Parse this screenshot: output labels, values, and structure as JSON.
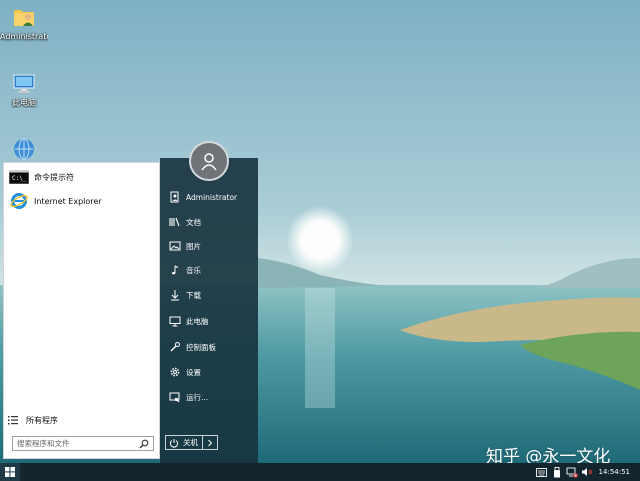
{
  "desktop": {
    "icons": [
      {
        "label": "Administrator",
        "icon": "user-folder-icon"
      },
      {
        "label": "此电脑",
        "icon": "computer-icon"
      },
      {
        "label": "",
        "icon": "network-icon"
      }
    ]
  },
  "start_menu": {
    "apps": [
      {
        "label": "命令提示符",
        "icon": "cmd-icon"
      },
      {
        "label": "Internet Explorer",
        "icon": "ie-icon"
      }
    ],
    "all_programs_label": "所有程序",
    "search": {
      "placeholder": "搜索程序和文件",
      "value": ""
    },
    "user_name": "Administrator",
    "right_items": [
      {
        "label": "文档",
        "icon": "documents-icon"
      },
      {
        "label": "图片",
        "icon": "pictures-icon"
      },
      {
        "label": "音乐",
        "icon": "music-icon"
      },
      {
        "label": "下载",
        "icon": "download-icon"
      },
      {
        "label": "此电脑",
        "icon": "computer-icon"
      },
      {
        "label": "控制面板",
        "icon": "control-panel-icon"
      },
      {
        "label": "设置",
        "icon": "settings-gear-icon"
      },
      {
        "label": "运行...",
        "icon": "run-icon"
      }
    ],
    "power_label": "关机",
    "accent_color": "#18343f"
  },
  "taskbar": {
    "clock": "14:54:51",
    "tray_icons": [
      "keyboard-icon",
      "usb-icon",
      "network-error-icon",
      "volume-muted-icon"
    ]
  },
  "watermark": "知乎 @永一文化"
}
